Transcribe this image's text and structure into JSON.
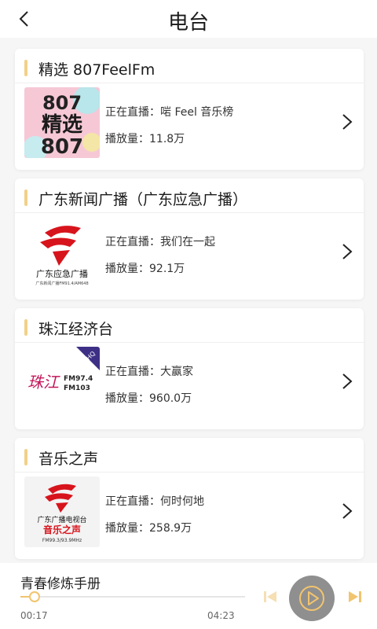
{
  "header": {
    "title": "电台",
    "back_icon": "chevron-left-icon"
  },
  "stations": [
    {
      "name": "精选 807FeelFm",
      "live_label": "正在直播：",
      "live_program": "啱 Feel 音乐榜",
      "plays_label": "播放量：",
      "plays": "11.8万",
      "logo_text_top": "807",
      "logo_text_mid": "精选",
      "logo_text_bottom": "807"
    },
    {
      "name": "广东新闻广播（广东应急广播）",
      "live_label": "正在直播：",
      "live_program": "我们在一起",
      "plays_label": "播放量：",
      "plays": "92.1万",
      "logo_caption": "广东应急广播",
      "logo_subcaption": "广东新闻广播FM91.4/AM648"
    },
    {
      "name": "珠江经济台",
      "live_label": "正在直播：",
      "live_program": "大赢家",
      "plays_label": "播放量：",
      "plays": "960.0万",
      "logo_script": "珠江",
      "logo_fm1": "FM97.4",
      "logo_fm2": "FM103",
      "logo_badge": "HQ"
    },
    {
      "name": "音乐之声",
      "live_label": "正在直播：",
      "live_program": "何时何地",
      "plays_label": "播放量：",
      "plays": "258.9万",
      "logo_caption_top": "广东广播电视台",
      "logo_caption": "音乐之声",
      "logo_subcaption": "FM99.3/93.9MHz"
    }
  ],
  "player": {
    "song_title": "青春修炼手册",
    "current_time": "00:17",
    "total_time": "04:23",
    "progress_fraction": 0.0646,
    "accent_color": "#f2c46e",
    "play_icon": "play-icon",
    "prev_icon": "skip-previous-icon",
    "next_icon": "skip-next-icon"
  }
}
